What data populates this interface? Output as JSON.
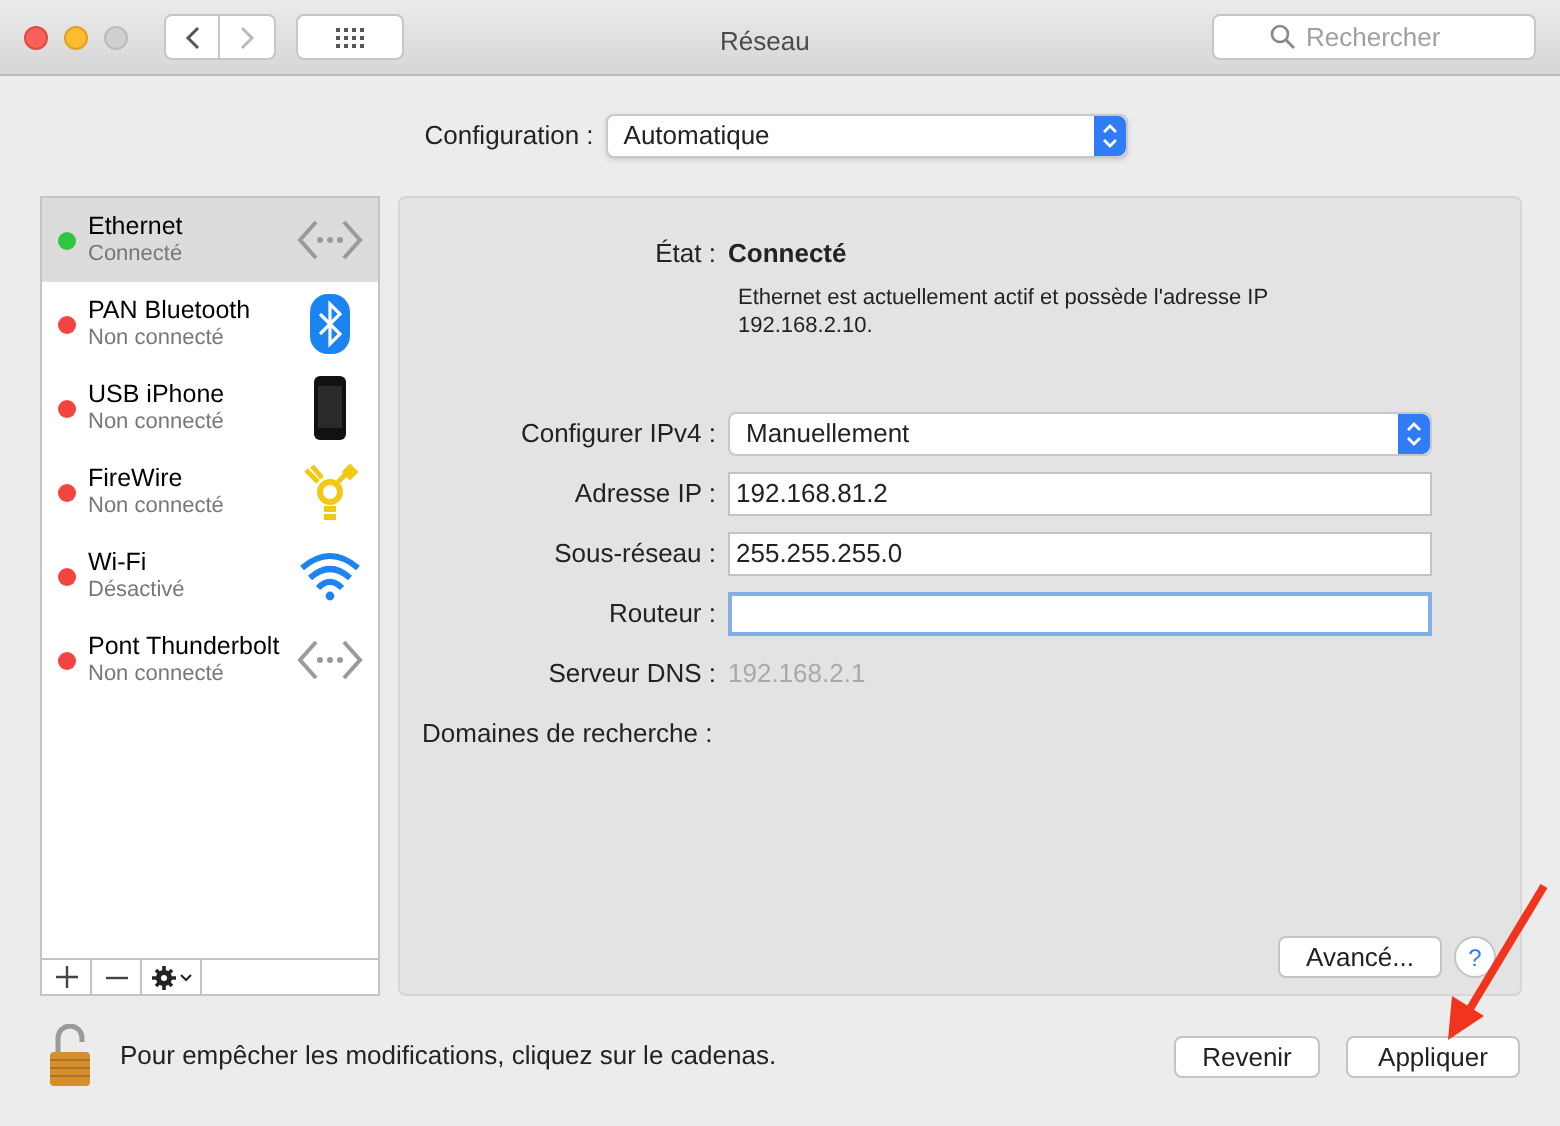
{
  "window": {
    "title": "Réseau",
    "search_placeholder": "Rechercher"
  },
  "configuration": {
    "label": "Configuration :",
    "value": "Automatique"
  },
  "services": [
    {
      "name": "Ethernet",
      "status": "Connecté",
      "color": "#2fc641",
      "kind": "ethernet",
      "selected": true
    },
    {
      "name": "PAN Bluetooth",
      "status": "Non connecté",
      "color": "#f2453d",
      "kind": "bluetooth",
      "selected": false
    },
    {
      "name": "USB iPhone",
      "status": "Non connecté",
      "color": "#f2453d",
      "kind": "phone",
      "selected": false
    },
    {
      "name": "FireWire",
      "status": "Non connecté",
      "color": "#f2453d",
      "kind": "firewire",
      "selected": false
    },
    {
      "name": "Wi-Fi",
      "status": "Désactivé",
      "color": "#f2453d",
      "kind": "wifi",
      "selected": false
    },
    {
      "name": "Pont Thunderbolt",
      "status": "Non connecté",
      "color": "#f2453d",
      "kind": "ethernet",
      "selected": false
    }
  ],
  "detail": {
    "state_label": "État :",
    "state_value": "Connecté",
    "description": "Ethernet est actuellement actif et possède l'adresse IP 192.168.2.10.",
    "fields": [
      {
        "kind": "select",
        "label": "Configurer IPv4 :",
        "value": "Manuellement"
      },
      {
        "kind": "input",
        "label": "Adresse IP :",
        "value": "192.168.81.2",
        "focused": false
      },
      {
        "kind": "input",
        "label": "Sous-réseau :",
        "value": "255.255.255.0",
        "focused": false
      },
      {
        "kind": "input",
        "label": "Routeur :",
        "focused": true
      },
      {
        "kind": "readonly",
        "label": "Serveur DNS :",
        "value": "192.168.2.1"
      },
      {
        "kind": "readonly",
        "label": "Domaines de recherche :"
      }
    ],
    "advanced_button": "Avancé...",
    "help_button": "?"
  },
  "footer": {
    "lock_text": "Pour empêcher les modifications, cliquez sur le cadenas.",
    "buttons": [
      "Revenir",
      "Appliquer"
    ]
  }
}
